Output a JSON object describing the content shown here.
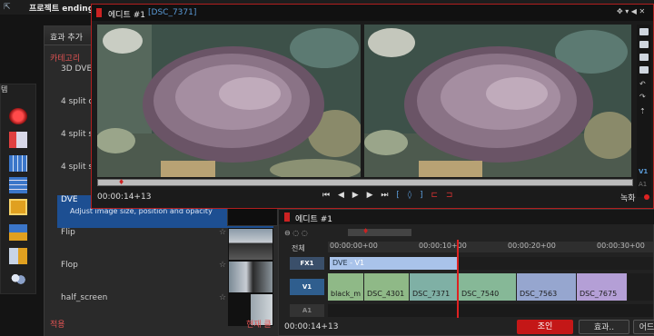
{
  "app": {
    "title_icon": "exit-icon",
    "title": "프로젝트 ending"
  },
  "left_tools": {
    "header": "템",
    "tools": [
      {
        "icon": "record-icon",
        "color": "#d42020"
      },
      {
        "icon": "capture-icon",
        "color": "#e04040"
      },
      {
        "icon": "grid-icon",
        "color": "#3b76c9"
      },
      {
        "icon": "film-icon",
        "color": "#3b76c9"
      },
      {
        "icon": "folder-icon",
        "color": "#e0a020"
      },
      {
        "icon": "network-icon",
        "color": "#3b76c9"
      },
      {
        "icon": "export-icon",
        "color": "#e0a020"
      },
      {
        "icon": "users-icon",
        "color": "#8aa0c8"
      }
    ]
  },
  "effects_panel": {
    "title": "효과 추가",
    "category_label": "카테고리",
    "items": [
      {
        "label": "3D DVE",
        "selected": false,
        "star": false
      },
      {
        "label": "4 split c",
        "selected": false,
        "star": false
      },
      {
        "label": "4 split s",
        "selected": false,
        "star": false
      },
      {
        "label": "4 split s",
        "selected": false,
        "star": false
      },
      {
        "label": "DVE",
        "description": "Adjust image size, position and opacity",
        "selected": true,
        "star": false
      },
      {
        "label": "Flip",
        "selected": false,
        "star": true
      },
      {
        "label": "Flop",
        "selected": false,
        "star": true
      },
      {
        "label": "half_screen",
        "selected": false,
        "star": true
      }
    ],
    "apply_label": "적용",
    "current_label": "현재 클"
  },
  "editor_top": {
    "title": "에디트 #1",
    "clip_name": "[DSC_7371]",
    "window_controls": "✥ ▾ ◀ ✕",
    "track_v1": "V1",
    "track_a1": "A1",
    "timecode": "00:00:14+13",
    "transport": {
      "skip_start": "⏮",
      "step_back": "◀",
      "play": "▶",
      "step_forward": "▶",
      "skip_end": "⏭",
      "mark_in": "⁅",
      "mark": "◊",
      "mark_out": "⁆",
      "clip_in": "⊏",
      "clip_out": "⊐"
    },
    "record_label": "녹화"
  },
  "timeline": {
    "title": "에디트 #1",
    "tools_text": "⊖ ◌ ◌",
    "all_label": "전체",
    "ruler": [
      "00:00:00+00",
      "00:00:10+00",
      "00:00:20+00",
      "00:00:30+00"
    ],
    "tracks": {
      "fx1": "FX1",
      "v1": "V1",
      "a1": "A1"
    },
    "dve_clip": {
      "label": "DVE",
      "suffix": " - V1"
    },
    "clips": [
      {
        "label": "black_m",
        "color": "#8fb987"
      },
      {
        "label": "DSC_4301",
        "color": "#8fb987"
      },
      {
        "label": "DSC_7371",
        "color": "#7fb0a5"
      },
      {
        "label": "DSC_7540",
        "color": "#86b897"
      },
      {
        "label": "DSC_7563",
        "color": "#96a6cf"
      },
      {
        "label": "DSC_7675",
        "color": "#b49fd6"
      }
    ],
    "timecode": "00:00:14+13",
    "buttons": {
      "join": "조인",
      "effects": "효과..",
      "more": "어드"
    }
  },
  "colors": {
    "accent_red": "#c41717",
    "selection_blue": "#1d4f92",
    "clip_name_blue": "#5b9bd8"
  }
}
